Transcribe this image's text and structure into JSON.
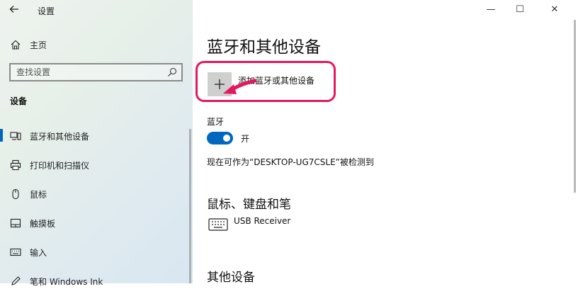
{
  "window": {
    "app_title": "设置",
    "controls": {
      "minimize": "—",
      "maximize": "☐",
      "close": "✕"
    }
  },
  "sidebar": {
    "home_label": "主页",
    "search_placeholder": "查找设置",
    "section_title": "设备",
    "items": [
      {
        "label": "蓝牙和其他设备",
        "icon": "bluetooth-devices-icon",
        "active": true
      },
      {
        "label": "打印机和扫描仪",
        "icon": "printer-icon"
      },
      {
        "label": "鼠标",
        "icon": "mouse-icon"
      },
      {
        "label": "触摸板",
        "icon": "touchpad-icon"
      },
      {
        "label": "输入",
        "icon": "keyboard-icon"
      },
      {
        "label": "笔和 Windows Ink",
        "icon": "pen-icon"
      }
    ]
  },
  "main": {
    "title": "蓝牙和其他设备",
    "add_device_label": "添加蓝牙或其他设备",
    "bluetooth": {
      "heading": "蓝牙",
      "toggle_state": "开",
      "toggle_on": true,
      "discoverable_text": "现在可作为“DESKTOP-UG7CSLE”被检测到"
    },
    "mouse_keyboard_pen": {
      "heading": "鼠标、键盘和笔",
      "devices": [
        {
          "name": "USB Receiver",
          "icon": "keyboard-icon"
        }
      ]
    },
    "other_devices": {
      "heading": "其他设备"
    }
  },
  "colors": {
    "accent": "#0067c0",
    "highlight": "#e3195f",
    "sidebar_tint": "#e3ecee"
  }
}
